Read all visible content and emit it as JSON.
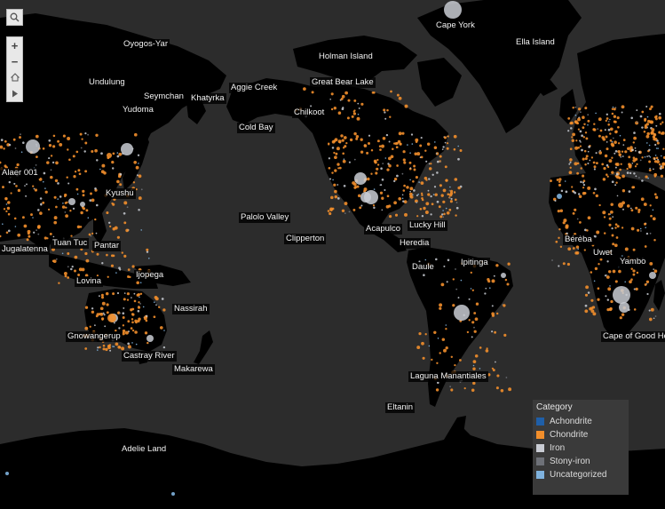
{
  "colors": {
    "ocean": "#2c2c2c",
    "land": "#000000",
    "achondrite": "#1f5fa8",
    "chondrite": "#f28e2b",
    "iron": "#c9ccd4",
    "stony_iron": "#6e7178",
    "uncategorized": "#7fb2de"
  },
  "controls": {
    "search_icon": "search-icon",
    "zoom_in": "+",
    "zoom_out": "−",
    "home_icon": "home-icon",
    "pan_icon": "play-icon"
  },
  "labels": [
    {
      "text": "Cape York"
    },
    {
      "text": "Ella Island"
    },
    {
      "text": "Oyogos-Yar"
    },
    {
      "text": "Holman Island"
    },
    {
      "text": "Undulung"
    },
    {
      "text": "Great Bear Lake"
    },
    {
      "text": "Seymchan"
    },
    {
      "text": "Aggie Creek"
    },
    {
      "text": "Khatyrka"
    },
    {
      "text": "Yudoma"
    },
    {
      "text": "Chilkoot"
    },
    {
      "text": "Cold Bay"
    },
    {
      "text": "Alaer 001"
    },
    {
      "text": "Kyushu"
    },
    {
      "text": "Palolo Valley"
    },
    {
      "text": "Acapulco"
    },
    {
      "text": "Lucky Hill"
    },
    {
      "text": "Clipperton"
    },
    {
      "text": "Heredia"
    },
    {
      "text": "Tuan Tuc"
    },
    {
      "text": "Bérėba"
    },
    {
      "text": "Pantar"
    },
    {
      "text": "Jugalatenna"
    },
    {
      "text": "Uwet"
    },
    {
      "text": "Ipitinga"
    },
    {
      "text": "Daule"
    },
    {
      "text": "Yambo"
    },
    {
      "text": "Ijopega"
    },
    {
      "text": "Lovina"
    },
    {
      "text": "Nassirah"
    },
    {
      "text": "Gnowangerup"
    },
    {
      "text": "Cape of Good Ho"
    },
    {
      "text": "Castray River"
    },
    {
      "text": "Makarewa"
    },
    {
      "text": "Laguna Manantiales"
    },
    {
      "text": "Eltanin"
    },
    {
      "text": "Adelie Land"
    }
  ],
  "legend": {
    "title": "Category",
    "items": [
      {
        "label": "Achondrite",
        "color": "#1f5fa8"
      },
      {
        "label": "Chondrite",
        "color": "#f28e2b"
      },
      {
        "label": "Iron",
        "color": "#c9ccd4"
      },
      {
        "label": "Stony-iron",
        "color": "#6e7178"
      },
      {
        "label": "Uncategorized",
        "color": "#7fb2de"
      }
    ]
  }
}
